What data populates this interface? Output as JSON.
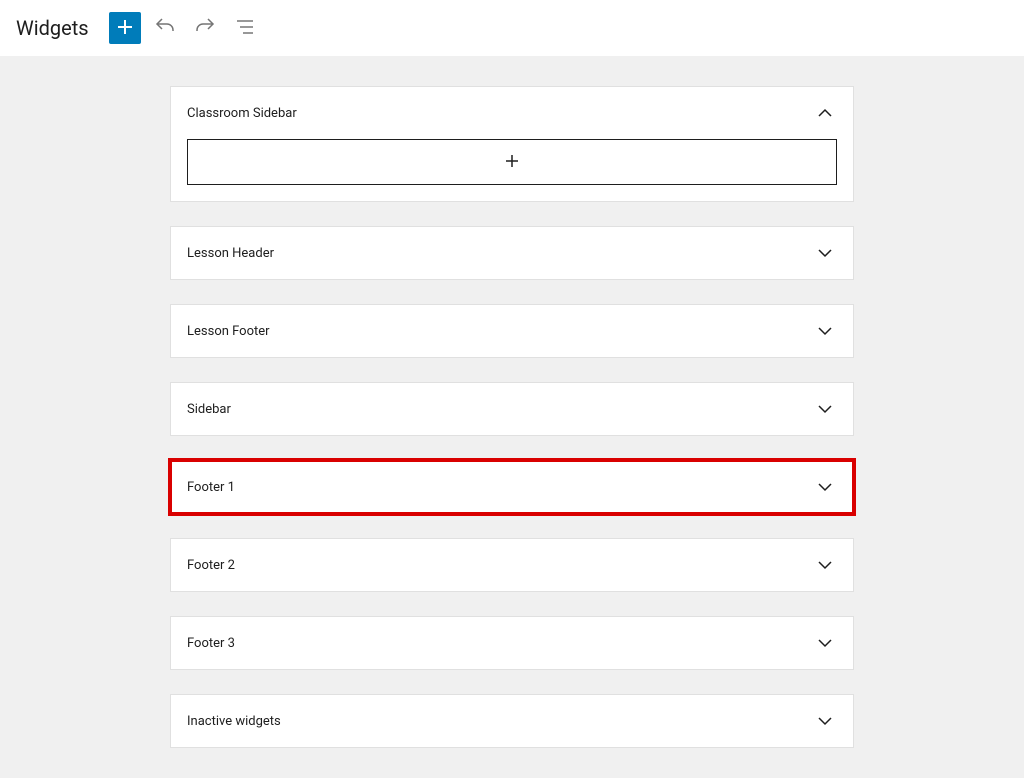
{
  "header": {
    "title": "Widgets"
  },
  "widgets": [
    {
      "title": "Classroom Sidebar",
      "expanded": true
    },
    {
      "title": "Lesson Header",
      "expanded": false
    },
    {
      "title": "Lesson Footer",
      "expanded": false
    },
    {
      "title": "Sidebar",
      "expanded": false
    },
    {
      "title": "Footer 1",
      "expanded": false,
      "highlighted": true
    },
    {
      "title": "Footer 2",
      "expanded": false
    },
    {
      "title": "Footer 3",
      "expanded": false
    },
    {
      "title": "Inactive widgets",
      "expanded": false
    }
  ]
}
